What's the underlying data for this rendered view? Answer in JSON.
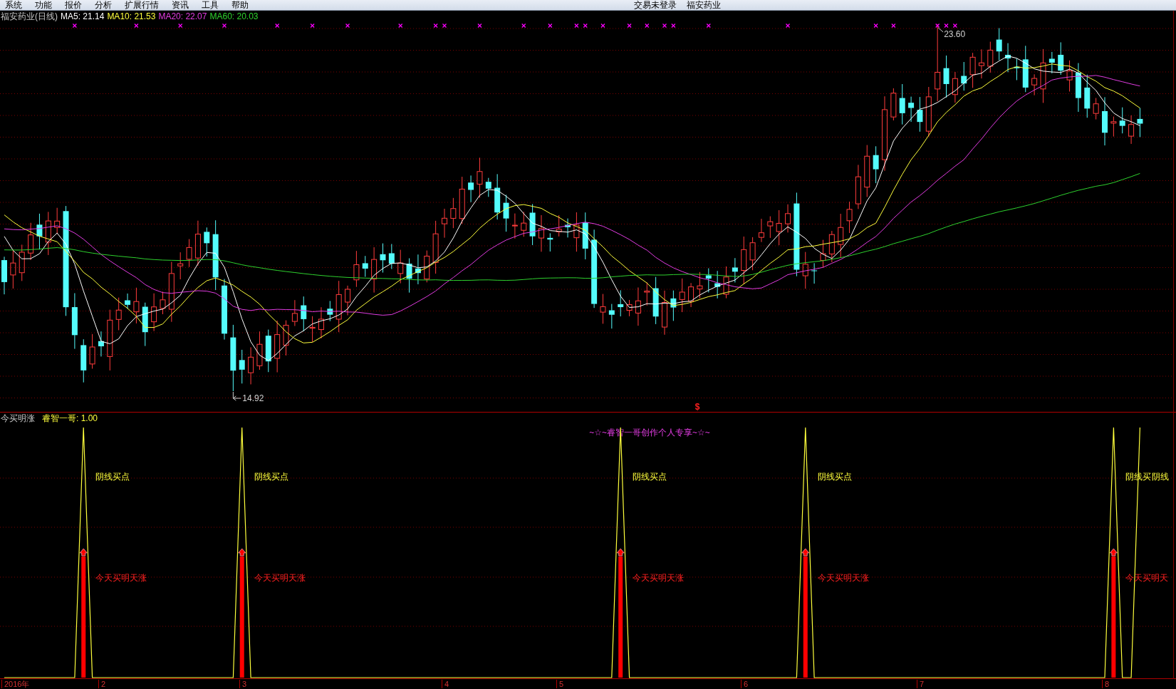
{
  "menu_bar": {
    "items": [
      "系统",
      "功能",
      "报价",
      "分析",
      "扩展行情",
      "资讯",
      "工具",
      "帮助"
    ],
    "status": [
      "交易未登录",
      "福安药业"
    ]
  },
  "price_panel": {
    "title": "福安药业(日线)",
    "indicators": [
      {
        "label": "MA5: 21.14",
        "color": "#ffffff"
      },
      {
        "label": "MA10: 21.53",
        "color": "#ffff3c"
      },
      {
        "label": "MA20: 22.07",
        "color": "#e23ce2"
      },
      {
        "label": "MA60: 20.03",
        "color": "#2ed22e"
      }
    ],
    "high_label": "23.60",
    "low_label": "14.92",
    "marker": "$"
  },
  "indicator_panel": {
    "title": "今买明涨",
    "value_label": "睿智一哥: 1.00",
    "banner": "~☆~睿智一哥创作个人专享~☆~",
    "signals": [
      {
        "kind": "confirmed",
        "top_label": "阴线买点",
        "bottom_label": "今天买明天涨"
      },
      {
        "kind": "confirmed",
        "top_label": "阴线买点",
        "bottom_label": "今天买明天涨"
      },
      {
        "kind": "confirmed",
        "top_label": "阴线买点",
        "bottom_label": "今天买明天涨"
      },
      {
        "kind": "confirmed",
        "top_label": "阴线买点",
        "bottom_label": "今天买明天涨"
      },
      {
        "kind": "confirmed",
        "top_label": "阴线买",
        "bottom_label": "今天买明天"
      },
      {
        "kind": "pending",
        "top_label": "阴线"
      }
    ]
  },
  "time_axis": {
    "labels": [
      "2016年",
      "2",
      "3",
      "4",
      "5",
      "6",
      "7",
      "8"
    ]
  }
}
